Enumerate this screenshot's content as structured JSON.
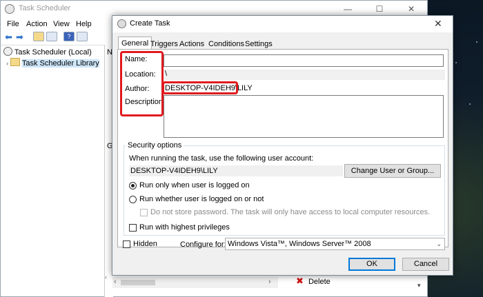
{
  "main_window": {
    "title": "Task Scheduler",
    "controls": [
      "—",
      "☐",
      "✕"
    ],
    "menu": [
      "File",
      "Action",
      "View",
      "Help"
    ],
    "tree": [
      {
        "label": "Task Scheduler (Local)",
        "selected": false
      },
      {
        "label": "Task Scheduler Library",
        "selected": true
      }
    ],
    "column_hint": "N",
    "lower_hint": "G",
    "actions_visible": [
      {
        "icon": "delete-icon",
        "label": "Delete"
      }
    ]
  },
  "dialog": {
    "title": "Create Task",
    "close": "✕",
    "tabs": [
      "General",
      "Triggers",
      "Actions",
      "Conditions",
      "Settings"
    ],
    "active_tab": "General",
    "fields": {
      "name_label": "Name:",
      "name_value": "",
      "location_label": "Location:",
      "location_value": "\\",
      "author_label": "Author:",
      "author_value": "DESKTOP-V4IDEH9\\LILY",
      "description_label": "Description:",
      "description_value": ""
    },
    "security": {
      "title": "Security options",
      "account_prompt": "When running the task, use the following user account:",
      "account_value": "DESKTOP-V4IDEH9\\LILY",
      "change_button": "Change User or Group...",
      "radio_logged_on": "Run only when user is logged on",
      "radio_whether": "Run whether user is logged on or not",
      "selected_radio": "logged_on",
      "no_store_password": "Do not store password.  The task will only have access to local computer resources.",
      "highest_privileges": "Run with highest privileges"
    },
    "hidden_label": "Hidden",
    "configure_for_label": "Configure for:",
    "configure_for_value": "Windows Vista™, Windows Server™ 2008",
    "ok_button": "OK",
    "cancel_button": "Cancel"
  },
  "colors": {
    "highlight": "#e0191e",
    "selection": "#cce4f7",
    "accent": "#0078d7"
  }
}
